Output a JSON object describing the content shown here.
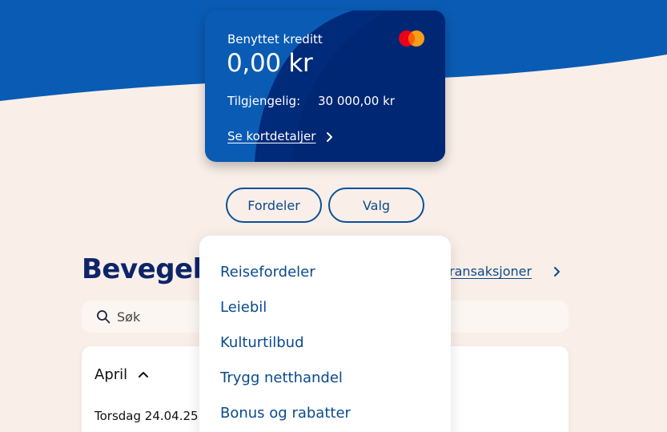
{
  "card": {
    "label": "Benyttet kreditt",
    "amount": "0,00 kr",
    "available_label": "Tilgjengelig:",
    "available_value": "30 000,00 kr",
    "details_link": "Se kortdetaljer",
    "brand_icon": "mastercard-logo"
  },
  "buttons": {
    "fordeler": "Fordeler",
    "valg": "Valg"
  },
  "dropdown": {
    "items": [
      "Reisefordeler",
      "Leiebil",
      "Kulturtilbud",
      "Trygg netthandel",
      "Bonus og rabatter"
    ]
  },
  "movements": {
    "title": "Bevegelser",
    "all_transactions_link": "Alle transaksjoner",
    "search_placeholder": "Søk",
    "month": "April",
    "day": "Torsdag 24.04.25"
  },
  "colors": {
    "header_blue": "#0a5bb3",
    "background": "#f9efe8",
    "accent": "#0a4a8c",
    "title": "#0d2468"
  }
}
